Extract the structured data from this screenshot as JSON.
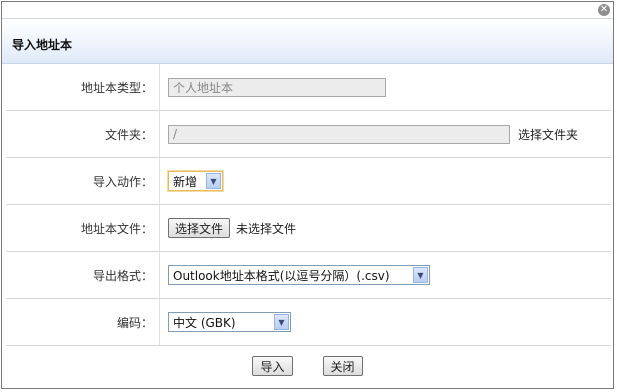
{
  "dialog": {
    "close_icon": "close-icon",
    "title": "导入地址本"
  },
  "form": {
    "type": {
      "label": "地址本类型：",
      "value": "个人地址本"
    },
    "folder": {
      "label": "文件夹：",
      "value": "/",
      "link": "选择文件夹"
    },
    "action": {
      "label": "导入动作：",
      "value": "新增"
    },
    "file": {
      "label": "地址本文件：",
      "button": "选择文件",
      "status": "未选择文件"
    },
    "format": {
      "label": "导出格式：",
      "value": "Outlook地址本格式(以逗号分隔）(.csv)"
    },
    "encoding": {
      "label": "编码：",
      "value": "中文 (GBK)"
    }
  },
  "footer": {
    "import_label": "导入",
    "close_label": "关闭"
  }
}
